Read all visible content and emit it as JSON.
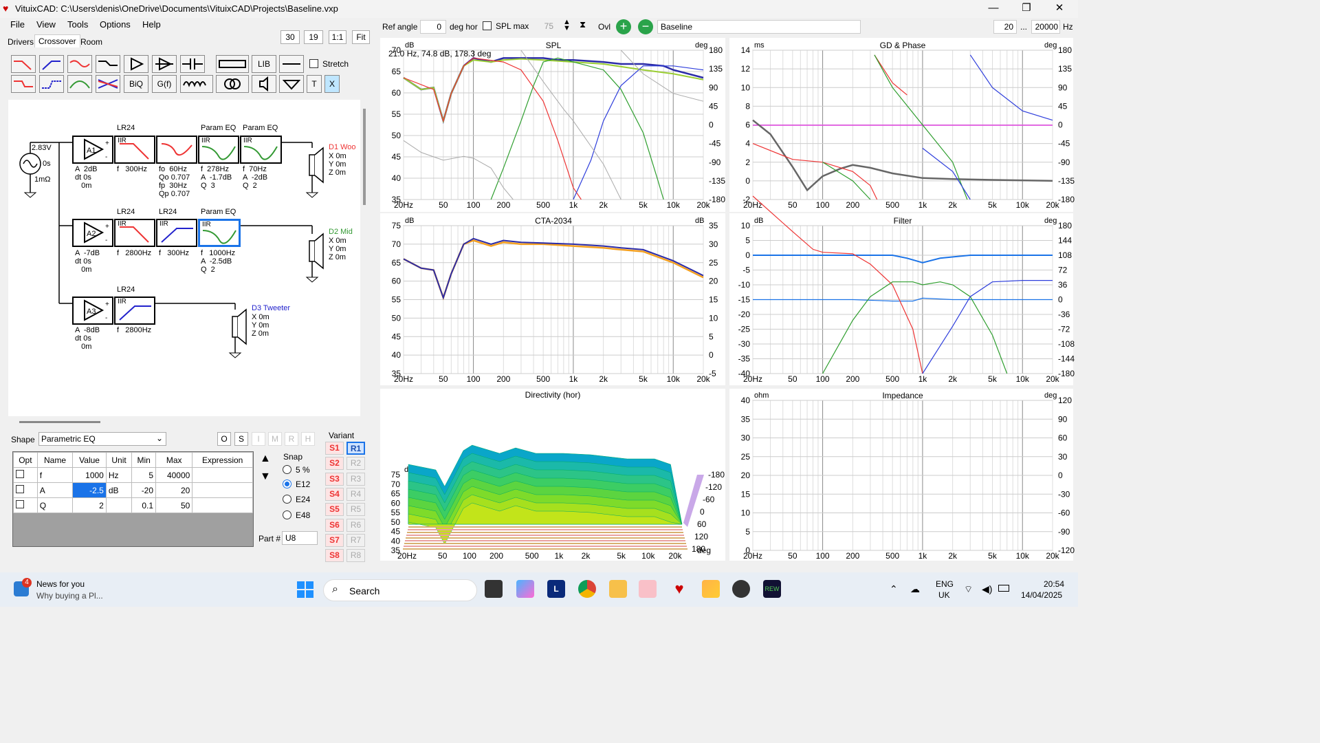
{
  "window": {
    "title": "VituixCAD: C:\\Users\\denis\\OneDrive\\Documents\\VituixCAD\\Projects\\Baseline.vxp"
  },
  "menu": [
    "File",
    "View",
    "Tools",
    "Options",
    "Help"
  ],
  "tabs": {
    "drivers": "Drivers",
    "crossover": "Crossover",
    "room": "Room"
  },
  "zoom": {
    "a": "30",
    "b": "19",
    "ratio": "1:1",
    "fit": "Fit"
  },
  "toolbar": {
    "lib": "LIB",
    "biq": "BiQ",
    "gf": "G(f)",
    "t": "T",
    "x": "X",
    "stretch": "Stretch"
  },
  "top": {
    "ref_angle_label": "Ref angle",
    "ref_angle": "0",
    "deg_hor": "deg hor",
    "spl_max": "SPL max",
    "spl_val": "75",
    "ovl": "Ovl",
    "variant_name": "Baseline",
    "f_min": "20",
    "dots": "...",
    "f_max": "20000",
    "hz": "Hz"
  },
  "schematic": {
    "source": {
      "v": "2.83V",
      "t": "0s",
      "r": "1mΩ"
    },
    "row1": {
      "a1": "A1",
      "a1_info": "A  2dB\ndt 0s\n   0m",
      "lr24": "LR24",
      "iir": "IIR",
      "f1": "f   300Hz",
      "pq1": "Param EQ",
      "pq2": "Param EQ",
      "b3": "fo  60Hz\nQo 0.707\nfp  30Hz\nQp 0.707",
      "b4": "f  278Hz\nA  -1.7dB\nQ  3",
      "b5": "f  70Hz\nA  -2dB\nQ  2",
      "d": "D1 Woo",
      "dpos": "X 0m\nY 0m\nZ 0m"
    },
    "row2": {
      "a2": "A2",
      "a2_info": "A  -7dB\ndt 0s\n   0m",
      "lr24a": "LR24",
      "lr24b": "LR24",
      "pq": "Param EQ",
      "f1": "f   2800Hz",
      "f2": "f   300Hz",
      "b4": "f   1000Hz\nA  -2.5dB\nQ  2",
      "d": "D2 Mid",
      "dpos": "X 0m\nY 0m\nZ 0m"
    },
    "row3": {
      "a3": "A3",
      "a3_info": "A  -8dB\ndt 0s\n   0m",
      "lr24": "LR24",
      "f1": "f   2800Hz",
      "d": "D3 Tweeter",
      "dpos": "X 0m\nY 0m\nZ 0m"
    }
  },
  "shape": {
    "label": "Shape",
    "value": "Parametric EQ",
    "btns": [
      "O",
      "S",
      "I",
      "M",
      "R",
      "H"
    ]
  },
  "params": {
    "headers": [
      "Opt",
      "Name",
      "Value",
      "Unit",
      "Min",
      "Max",
      "Expression"
    ],
    "rows": [
      [
        "",
        "f",
        "1000",
        "Hz",
        "5",
        "40000",
        ""
      ],
      [
        "",
        "A",
        "-2.5",
        "dB",
        "-20",
        "20",
        ""
      ],
      [
        "",
        "Q",
        "2",
        "",
        "0.1",
        "50",
        ""
      ]
    ]
  },
  "snap": {
    "label": "Snap",
    "options": [
      "5 %",
      "E12",
      "E24",
      "E48"
    ],
    "selected": "E12"
  },
  "part": {
    "label": "Part #",
    "value": "U8"
  },
  "variant": {
    "label": "Variant",
    "s": [
      "S1",
      "S2",
      "S3",
      "S4",
      "S5",
      "S6",
      "S7",
      "S8"
    ],
    "r": [
      "R1",
      "R2",
      "R3",
      "R4",
      "R5",
      "R6",
      "R7",
      "R8"
    ]
  },
  "charts": {
    "spl": {
      "title": "SPL",
      "unit_l": "dB",
      "unit_r": "deg",
      "cursor": "21.0 Hz, 74.8 dB, 178.3 deg",
      "yl": [
        "70",
        "65",
        "60",
        "55",
        "50",
        "45",
        "40",
        "35"
      ],
      "yr": [
        "180",
        "135",
        "90",
        "45",
        "0",
        "-45",
        "-90",
        "-135",
        "-180"
      ],
      "x": [
        "20Hz",
        "50",
        "100",
        "200",
        "500",
        "1k",
        "2k",
        "5k",
        "10k",
        "20k"
      ]
    },
    "gd": {
      "title": "GD & Phase",
      "unit_l": "ms",
      "unit_r": "deg",
      "yl": [
        "14",
        "12",
        "10",
        "8",
        "6",
        "4",
        "2",
        "0",
        "-2"
      ],
      "yr": [
        "180",
        "135",
        "90",
        "45",
        "0",
        "-45",
        "-90",
        "-135",
        "-180"
      ],
      "x": [
        "20Hz",
        "50",
        "100",
        "200",
        "500",
        "1k",
        "2k",
        "5k",
        "10k",
        "20k"
      ]
    },
    "cta": {
      "title": "CTA-2034",
      "unit_l": "dB",
      "unit_r": "dB",
      "yl": [
        "75",
        "70",
        "65",
        "60",
        "55",
        "50",
        "45",
        "40",
        "35"
      ],
      "yr": [
        "35",
        "30",
        "25",
        "20",
        "15",
        "10",
        "5",
        "0",
        "-5"
      ],
      "x": [
        "20Hz",
        "50",
        "100",
        "200",
        "500",
        "1k",
        "2k",
        "5k",
        "10k",
        "20k"
      ]
    },
    "filter": {
      "title": "Filter",
      "unit_l": "dB",
      "unit_r": "deg",
      "yl": [
        "10",
        "5",
        "0",
        "-5",
        "-10",
        "-15",
        "-20",
        "-25",
        "-30",
        "-35",
        "-40"
      ],
      "yr": [
        "180",
        "144",
        "108",
        "72",
        "36",
        "0",
        "-36",
        "-72",
        "-108",
        "-144",
        "-180"
      ],
      "x": [
        "20Hz",
        "50",
        "100",
        "200",
        "500",
        "1k",
        "2k",
        "5k",
        "10k",
        "20k"
      ]
    },
    "dir": {
      "title": "Directivity (hor)",
      "unit": "dB",
      "yl": [
        "75",
        "70",
        "65",
        "60",
        "55",
        "50",
        "45",
        "40",
        "35"
      ],
      "angles": [
        "-180",
        "-120",
        "-60",
        "0",
        "60",
        "120",
        "180"
      ],
      "deg": "deg",
      "x": [
        "20Hz",
        "50",
        "100",
        "200",
        "500",
        "1k",
        "2k",
        "5k",
        "10k",
        "20k"
      ]
    },
    "imp": {
      "title": "Impedance",
      "unit_l": "ohm",
      "unit_r": "deg",
      "yl": [
        "40",
        "35",
        "30",
        "25",
        "20",
        "15",
        "10",
        "5",
        "0"
      ],
      "yr": [
        "120",
        "90",
        "60",
        "30",
        "0",
        "-30",
        "-60",
        "-90",
        "-120"
      ],
      "x": [
        "20Hz",
        "50",
        "100",
        "200",
        "500",
        "1k",
        "2k",
        "5k",
        "10k",
        "20k"
      ]
    }
  },
  "taskbar": {
    "news_title": "News for you",
    "news_sub": "Why buying a Pl...",
    "badge": "4",
    "search": "Search",
    "lang1": "ENG",
    "lang2": "UK",
    "time": "20:54",
    "date": "14/04/2025"
  }
}
